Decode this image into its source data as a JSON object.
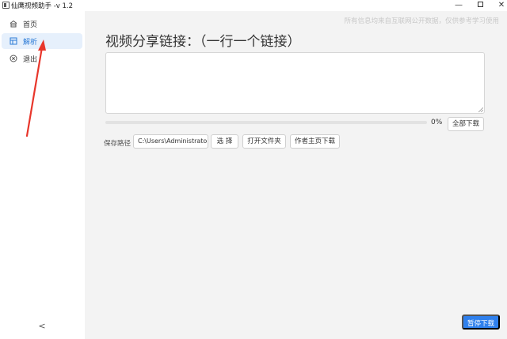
{
  "window": {
    "title": "仙鹰视频助手 -v 1.2",
    "minimize_glyph": "—",
    "close_glyph": "✕"
  },
  "sidebar": {
    "items": [
      {
        "label": "首页",
        "icon": "home-icon",
        "active": false
      },
      {
        "label": "解析",
        "icon": "parse-icon",
        "active": true
      },
      {
        "label": "退出",
        "icon": "exit-icon",
        "active": false
      }
    ],
    "collapse_glyph": "<"
  },
  "main": {
    "watermark": "所有信息均来自互联网公开数据，仅供参考学习使用",
    "heading": "视频分享链接：（一行一个链接）",
    "link_input": {
      "value": "",
      "placeholder": ""
    },
    "progress": {
      "percent": 0,
      "text": "0%"
    },
    "download_all_label": "全部下载",
    "save_path_label": "保存路径",
    "save_path_value": "C:\\Users\\Administrator\\I",
    "choose_label": "选 择",
    "open_folder_label": "打开文件夹",
    "author_page_label": "作者主页下载",
    "pause_label": "暂停下载"
  },
  "colors": {
    "accent": "#2f80ed",
    "active_nav_bg": "#e6f0fc",
    "annotation_arrow": "#e8362b"
  }
}
